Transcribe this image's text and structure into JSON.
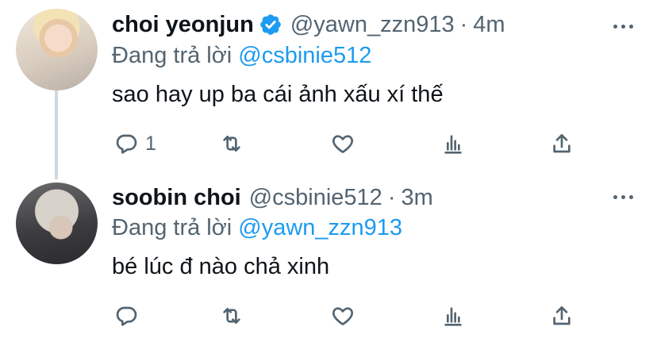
{
  "tweets": [
    {
      "display_name": "choi yeonjun",
      "verified": true,
      "handle": "@yawn_zzn913",
      "separator": "·",
      "time": "4m",
      "reply_prefix": "Đang trả lời",
      "reply_to": "@csbinie512",
      "text": "sao hay up ba cái ảnh xấu xí thế",
      "reply_count": "1"
    },
    {
      "display_name": "soobin choi",
      "verified": false,
      "handle": "@csbinie512",
      "separator": "·",
      "time": "3m",
      "reply_prefix": "Đang trả lời",
      "reply_to": "@yawn_zzn913",
      "text": "bé lúc đ nào chả xinh",
      "reply_count": ""
    }
  ],
  "icons": [
    "reply-icon",
    "retweet-icon",
    "like-icon",
    "views-icon",
    "share-icon",
    "more-icon",
    "verified-badge-icon"
  ],
  "colors": {
    "link": "#1d9bf0",
    "secondary_text": "#536471",
    "thread_line": "#cfd9de",
    "verified": "#1d9bf0"
  }
}
